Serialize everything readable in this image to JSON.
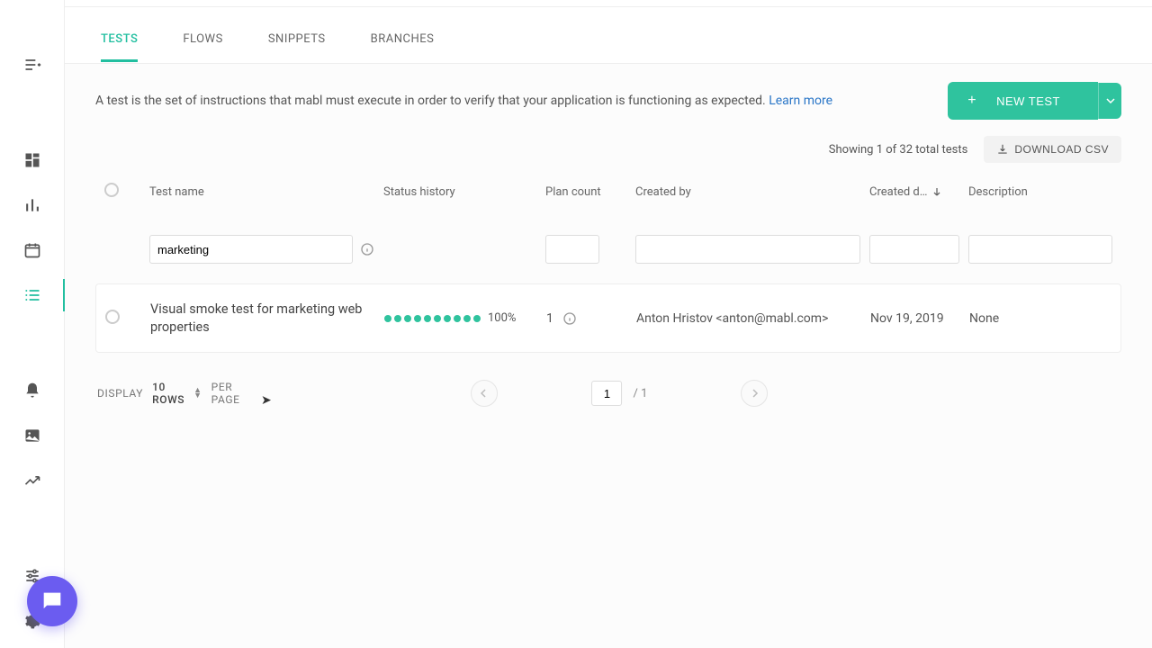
{
  "tabs": {
    "tests": "TESTS",
    "flows": "FLOWS",
    "snippets": "SNIPPETS",
    "branches": "BRANCHES"
  },
  "description": {
    "text": "A test is the set of instructions that mabl must execute in order to verify that your application is functioning as expected.  ",
    "learn_more": "Learn more"
  },
  "buttons": {
    "new_test": "NEW TEST",
    "download_csv": "DOWNLOAD CSV"
  },
  "summary": "Showing 1 of 32 total tests",
  "columns": {
    "test_name": "Test name",
    "status_history": "Status history",
    "plan_count": "Plan count",
    "created_by": "Created by",
    "created_date": "Created d…",
    "description": "Description"
  },
  "filters": {
    "test_name_value": "marketing"
  },
  "row": {
    "name": "Visual smoke test for marketing web properties",
    "status_pct": "100%",
    "status_dots": 10,
    "plan_count": "1",
    "created_by": "Anton Hristov <anton@mabl.com>",
    "created_date": "Nov 19, 2019",
    "description": "None"
  },
  "pager": {
    "display_label": "DISPLAY",
    "rows": "10 ROWS",
    "per_page": "PER PAGE",
    "page": "1",
    "total": "/ 1"
  }
}
